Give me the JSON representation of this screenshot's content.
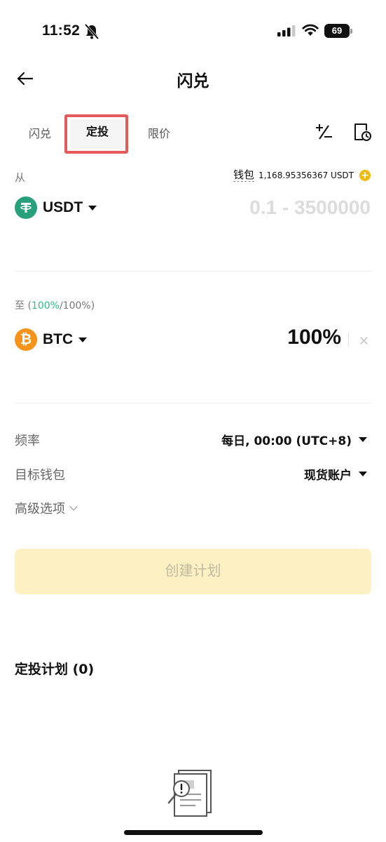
{
  "status_bar": {
    "time": "11:52",
    "battery": "69"
  },
  "header": {
    "title": "闪兑"
  },
  "tabs": [
    {
      "label": "闪兑"
    },
    {
      "label": "定投"
    },
    {
      "label": "限价"
    }
  ],
  "from": {
    "label": "从",
    "wallet_label": "钱包",
    "wallet_balance": "1,168.95356367 USDT",
    "coin": "USDT",
    "amount_placeholder": "0.1 - 3500000"
  },
  "to": {
    "label_prefix": "至 (",
    "label_pct": "100%",
    "label_suffix": "/100%)",
    "coin": "BTC",
    "percentage": "100%"
  },
  "settings": {
    "frequency_label": "频率",
    "frequency_value": "每日, 00:00 (UTC+8)",
    "target_wallet_label": "目标钱包",
    "target_wallet_value": "现货账户",
    "advanced_label": "高级选项"
  },
  "create_button": "创建计划",
  "plans_title": "定投计划 (0)",
  "colors": {
    "accent": "#f0b90b",
    "green": "#2ebd85",
    "usdt": "#26a17b",
    "btc": "#f7931a",
    "button_bg": "#fdf1c3"
  }
}
